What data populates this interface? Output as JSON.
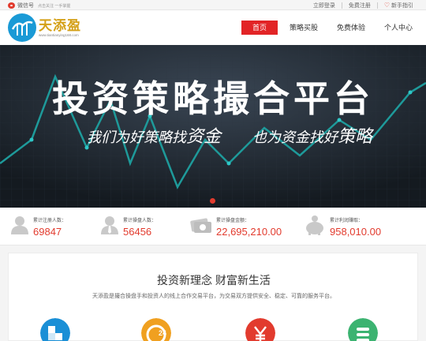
{
  "topbar": {
    "weibo_label": "微信号",
    "weibo_sub": "点击关注 一手掌握",
    "login": "立即登录",
    "register": "免费注册",
    "guide": "新手指引"
  },
  "logo": {
    "name": "天添盈",
    "url": "www.tiantianying168.com"
  },
  "nav": [
    {
      "label": "首页",
      "active": true
    },
    {
      "label": "策略买股"
    },
    {
      "label": "免费体验"
    },
    {
      "label": "个人中心"
    }
  ],
  "banner": {
    "title": "投资策略撮合平台",
    "sub_a1": "我们为好策略找",
    "sub_a2": "资金",
    "sub_b1": "也为资金找好",
    "sub_b2": "策略"
  },
  "stats": [
    {
      "label": "累计注册人数：",
      "value": "69847"
    },
    {
      "label": "累计操盘人数：",
      "value": "56456"
    },
    {
      "label": "累计操盘金额：",
      "value": "22,695,210.00"
    },
    {
      "label": "累计利润赚取：",
      "value": "958,010.00"
    }
  ],
  "main": {
    "heading": "投资新理念 财富新生活",
    "desc": "天添盈是撮合操盘手和投资人的线上合作交易平台，为交易双方提供安全、稳定、可靠的服务平台。"
  },
  "colors": {
    "accent": "#e22426",
    "logo_blue": "#1a9ad6",
    "logo_gold": "#d4a017",
    "banner_bg": "#1b2128",
    "line": "#1e9a9a"
  },
  "feature_icons": [
    "blue-square-icon",
    "orange-24h-icon",
    "red-yen-icon",
    "green-list-icon"
  ]
}
